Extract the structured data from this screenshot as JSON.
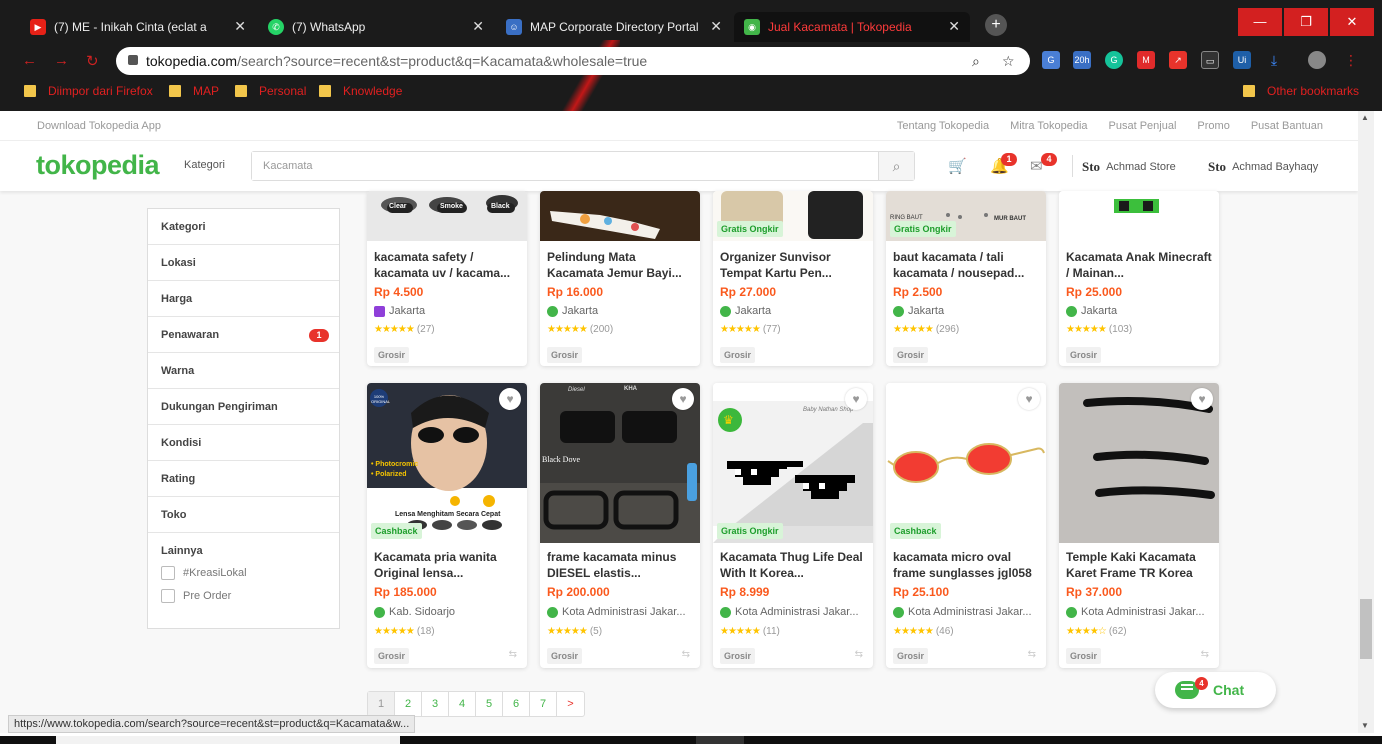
{
  "browser": {
    "tabs": [
      {
        "title": "(7) ME - Inikah Cinta (eclat a",
        "icon": "youtube-icon"
      },
      {
        "title": "(7) WhatsApp",
        "icon": "whatsapp-icon"
      },
      {
        "title": "MAP Corporate Directory Portal",
        "icon": "directory-icon"
      },
      {
        "title": "Jual Kacamata | Tokopedia",
        "icon": "tokopedia-icon",
        "active": true
      }
    ],
    "url_host": "tokopedia.com",
    "url_rest": "/search?source=recent&st=product&q=Kacamata&wholesale=true",
    "ext_badge": "20h",
    "bookmarks": [
      "Diimpor dari Firefox",
      "MAP",
      "Personal",
      "Knowledge"
    ],
    "other_bookmarks": "Other bookmarks",
    "status_url": "https://www.tokopedia.com/search?source=recent&st=product&q=Kacamata&w..."
  },
  "topbar": {
    "download": "Download Tokopedia App",
    "links": [
      "Tentang Tokopedia",
      "Mitra Tokopedia",
      "Pusat Penjual",
      "Promo",
      "Pusat Bantuan"
    ]
  },
  "header": {
    "logo": "tokopedia",
    "kategori": "Kategori",
    "search_value": "Kacamata",
    "notif_count": "1",
    "inbox_count": "4",
    "store_name": "Achmad Store",
    "user_name": "Achmad Bayhaqy",
    "sto": "Sto"
  },
  "filters": {
    "items": [
      "Kategori",
      "Lokasi",
      "Harga",
      "Penawaran",
      "Warna",
      "Dukungan Pengiriman",
      "Kondisi",
      "Rating",
      "Toko"
    ],
    "penawaran_badge": "1",
    "lainnya": "Lainnya",
    "checks": [
      "#KreasiLokal",
      "Pre Order"
    ]
  },
  "products_row1": [
    {
      "name": "kacamata safety / kacamata uv / kacama...",
      "price": "Rp 4.500",
      "location": "Jakarta",
      "reviews": "(27)",
      "stars": "★★★★★",
      "tag": "",
      "badge": "Grosir",
      "shop": "#8f3fd9"
    },
    {
      "name": "Pelindung Mata Kacamata Jemur Bayi...",
      "price": "Rp 16.000",
      "location": "Jakarta",
      "reviews": "(200)",
      "stars": "★★★★★",
      "tag": "",
      "badge": "Grosir",
      "shop": "#42b549"
    },
    {
      "name": "Organizer Sunvisor Tempat Kartu Pen...",
      "price": "Rp 27.000",
      "location": "Jakarta",
      "reviews": "(77)",
      "stars": "★★★★★",
      "tag": "Gratis Ongkir",
      "badge": "Grosir",
      "shop": "#42b549"
    },
    {
      "name": "baut kacamata / tali kacamata / nousepad...",
      "price": "Rp 2.500",
      "location": "Jakarta",
      "reviews": "(296)",
      "stars": "★★★★★",
      "tag": "Gratis Ongkir",
      "badge": "Grosir",
      "shop": "#42b549"
    },
    {
      "name": "Kacamata Anak Minecraft / Mainan...",
      "price": "Rp 25.000",
      "location": "Jakarta",
      "reviews": "(103)",
      "stars": "★★★★★",
      "tag": "",
      "badge": "Grosir",
      "shop": "#42b549"
    }
  ],
  "products_row2": [
    {
      "name": "Kacamata pria wanita Original lensa...",
      "price": "Rp 185.000",
      "location": "Kab. Sidoarjo",
      "reviews": "(18)",
      "stars": "★★★★★",
      "tag": "Cashback",
      "badge": "Grosir",
      "shop": "#42b549",
      "img_text1": "• Photocromic",
      "img_text2": "• Polarized",
      "img_text3": "Lensa Menghitam Secara Cepat",
      "img_text4": "100% ORIGINAL"
    },
    {
      "name": "frame kacamata minus DIESEL elastis...",
      "price": "Rp 200.000",
      "location": "Kota Administrasi Jakar...",
      "reviews": "(5)",
      "stars": "★★★★★",
      "tag": "",
      "badge": "Grosir",
      "shop": "#42b549",
      "img_text1": "Black Dove",
      "img_text2": "Diesel",
      "img_text3": "KHA"
    },
    {
      "name": "Kacamata Thug Life Deal With It Korea...",
      "price": "Rp 8.999",
      "location": "Kota Administrasi Jakar...",
      "reviews": "(11)",
      "stars": "★★★★★",
      "tag": "Gratis Ongkir",
      "badge": "Grosir",
      "shop": "#42b549",
      "img_text1": "Baby Nathan Shop"
    },
    {
      "name": "kacamata micro oval frame sunglasses jgl058",
      "price": "Rp 25.100",
      "location": "Kota Administrasi Jakar...",
      "reviews": "(46)",
      "stars": "★★★★★",
      "tag": "Cashback",
      "badge": "Grosir",
      "shop": "#42b549"
    },
    {
      "name": "Temple Kaki Kacamata Karet Frame TR Korea",
      "price": "Rp 37.000",
      "location": "Kota Administrasi Jakar...",
      "reviews": "(62)",
      "stars": "★★★★☆",
      "tag": "",
      "badge": "Grosir",
      "shop": "#42b549"
    }
  ],
  "row1_img_text": [
    "Clear",
    "Smoke",
    "Black",
    "RING BAUT",
    "MUR BAUT"
  ],
  "pagination": [
    "1",
    "2",
    "3",
    "4",
    "5",
    "6",
    "7",
    ">"
  ],
  "chat": {
    "label": "Chat",
    "count": "4"
  }
}
